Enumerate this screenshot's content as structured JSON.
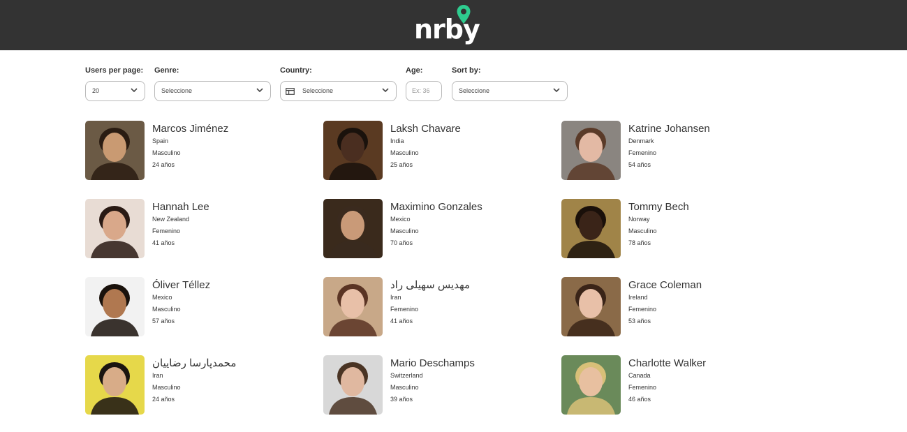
{
  "app": {
    "logo_text": "nrby",
    "brand_color": "#2ecc8f",
    "header_color": "#333333"
  },
  "filters": {
    "users_per_page": {
      "label": "Users per page:",
      "value": "20"
    },
    "genre": {
      "label": "Genre:",
      "value": "Seleccione"
    },
    "country": {
      "label": "Country:",
      "value": "Seleccione"
    },
    "age": {
      "label": "Age:",
      "placeholder": "Ex: 36"
    },
    "sort_by": {
      "label": "Sort by:",
      "value": "Seleccione"
    }
  },
  "users": [
    {
      "name": "Marcos Jiménez",
      "country": "Spain",
      "gender": "Masculino",
      "age": "24 años",
      "bg": "#6b5a45",
      "skin": "#c99a72",
      "hair": "#2a1c12"
    },
    {
      "name": "Laksh Chavare",
      "country": "India",
      "gender": "Masculino",
      "age": "25 años",
      "bg": "#5a3a22",
      "skin": "#4a2e20",
      "hair": "#1a120c"
    },
    {
      "name": "Katrine Johansen",
      "country": "Denmark",
      "gender": "Femenino",
      "age": "54 años",
      "bg": "#8a8580",
      "skin": "#e3b9a4",
      "hair": "#5a3a28"
    },
    {
      "name": "Hannah Lee",
      "country": "New Zealand",
      "gender": "Femenino",
      "age": "41 años",
      "bg": "#e8dcd4",
      "skin": "#d9a88a",
      "hair": "#2a1a14"
    },
    {
      "name": "Maximino Gonzales",
      "country": "Mexico",
      "gender": "Masculino",
      "age": "70 años",
      "bg": "#3a2a1c",
      "skin": "#c99a78",
      "hair": "#3a2a1e"
    },
    {
      "name": "Tommy Bech",
      "country": "Norway",
      "gender": "Masculino",
      "age": "78 años",
      "bg": "#a08448",
      "skin": "#3a2418",
      "hair": "#1a100a"
    },
    {
      "name": "Óliver Téllez",
      "country": "Mexico",
      "gender": "Masculino",
      "age": "57 años",
      "bg": "#f2f2f2",
      "skin": "#b07850",
      "hair": "#1a120c"
    },
    {
      "name": "مهدیس سهیلی راد",
      "country": "Iran",
      "gender": "Femenino",
      "age": "41 años",
      "bg": "#c8a888",
      "skin": "#e8c0a8",
      "hair": "#5a3424"
    },
    {
      "name": "Grace Coleman",
      "country": "Ireland",
      "gender": "Femenino",
      "age": "53 años",
      "bg": "#8a6a48",
      "skin": "#e8c0a8",
      "hair": "#3a2418"
    },
    {
      "name": "محمدپارسا رضاییان",
      "country": "Iran",
      "gender": "Masculino",
      "age": "24 años",
      "bg": "#e6d84a",
      "skin": "#d8ac88",
      "hair": "#1a1410"
    },
    {
      "name": "Mario Deschamps",
      "country": "Switzerland",
      "gender": "Masculino",
      "age": "39 años",
      "bg": "#d8d8d8",
      "skin": "#e0b8a0",
      "hair": "#4a3424"
    },
    {
      "name": "Charlotte Walker",
      "country": "Canada",
      "gender": "Femenino",
      "age": "46 años",
      "bg": "#6a8a5a",
      "skin": "#e8c0a0",
      "hair": "#d8c078"
    }
  ]
}
